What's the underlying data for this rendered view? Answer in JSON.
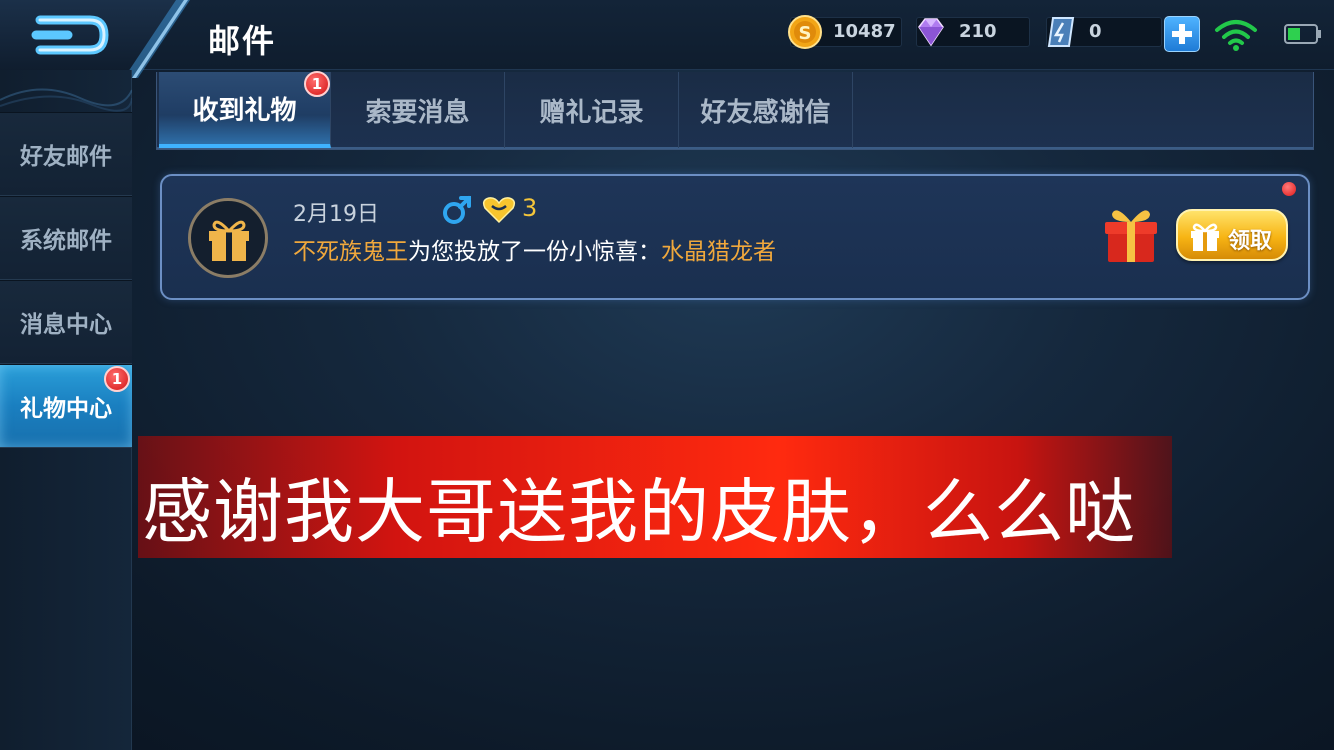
{
  "header": {
    "title": "邮件",
    "gold": "10487",
    "diamonds": "210",
    "vouchers": "0"
  },
  "sidebar": {
    "items": [
      {
        "label": "好友邮件"
      },
      {
        "label": "系统邮件"
      },
      {
        "label": "消息中心"
      },
      {
        "label": "礼物中心",
        "badge": "1"
      }
    ]
  },
  "tabs": [
    {
      "label": "收到礼物",
      "badge": "1"
    },
    {
      "label": "索要消息"
    },
    {
      "label": "赠礼记录"
    },
    {
      "label": "好友感谢信"
    }
  ],
  "mail": {
    "date": "2月19日",
    "intimacy": "3",
    "sender": "不死族鬼王",
    "message": "为您投放了一份小惊喜：",
    "item": "水晶猎龙者",
    "claim_label": "领取"
  },
  "caption": "感谢我大哥送我的皮肤，么么哒",
  "colors": {
    "accent_blue": "#2a9fd9",
    "gold_text": "#f0a83c",
    "badge_red": "#d31414",
    "caption_red": "#ff2a0f"
  },
  "icons": [
    "back-icon",
    "gold-coin-icon",
    "diamond-icon",
    "voucher-icon",
    "plus-icon",
    "wifi-icon",
    "battery-icon",
    "gift-icon",
    "male-icon",
    "heart-icon",
    "gift-box-icon"
  ]
}
